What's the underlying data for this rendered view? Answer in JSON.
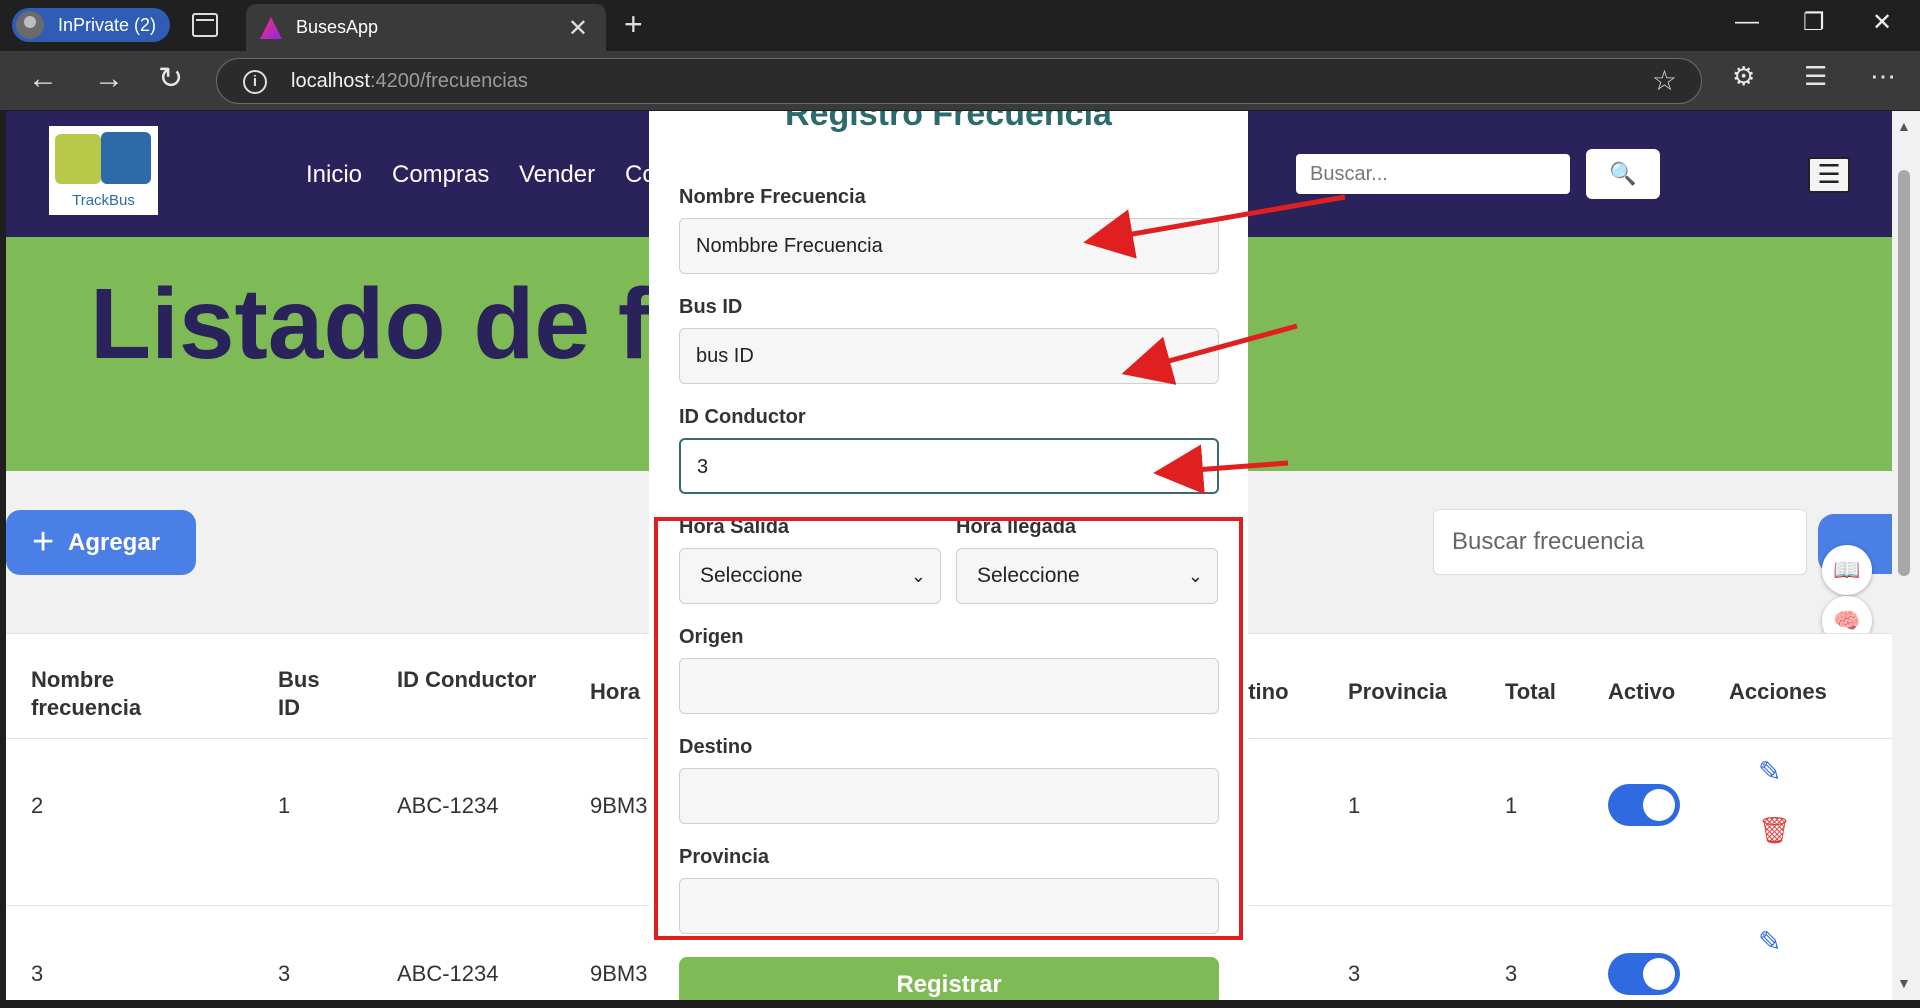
{
  "browser": {
    "profile_label": "InPrivate (2)",
    "tab_title": "BusesApp",
    "tab_close": "✕",
    "new_tab": "+",
    "url_host": "localhost",
    "url_path": ":4200/frecuencias",
    "window_controls": [
      "—",
      "❐",
      "✕"
    ]
  },
  "header": {
    "logo_text": "TrackBus",
    "menu": [
      "Inicio",
      "Compras",
      "Vender",
      "Co"
    ],
    "search_placeholder": "Buscar...",
    "search_icon": "🔍",
    "hamburger": "☰"
  },
  "hero": {
    "title": "Listado de f"
  },
  "list": {
    "add_label": "Agregar",
    "add_icon": "+",
    "search_placeholder": "Buscar frecuencia"
  },
  "table": {
    "headers": [
      "Nombre frecuencia",
      "Bus ID",
      "ID Conductor",
      "Hora",
      "stino",
      "Provincia",
      "Total",
      "Activo",
      "Acciones"
    ],
    "rows": [
      {
        "nombre": "2",
        "bus": "1",
        "conductor": "ABC-1234",
        "hora": "9BM3",
        "provincia": "1",
        "total": "1"
      },
      {
        "nombre": "3",
        "bus": "3",
        "conductor": "ABC-1234",
        "hora": "9BM3",
        "provincia": "3",
        "total": "3"
      }
    ]
  },
  "modal": {
    "title": "Registro Frecuencia",
    "fields": {
      "nombre_label": "Nombre Frecuencia",
      "nombre_value": "Nombbre Frecuencia",
      "bus_label": "Bus ID",
      "bus_value": "bus ID",
      "conductor_label": "ID Conductor",
      "conductor_value": "3",
      "salida_label": "Hora Salida",
      "salida_value": "Seleccione",
      "llegada_label": "Hora llegada",
      "llegada_value": "Seleccione",
      "origen_label": "Origen",
      "destino_label": "Destino",
      "provincia_label": "Provincia"
    },
    "submit_label": "Registrar"
  },
  "icons": {
    "back": "back-arrow-icon",
    "forward": "forward-arrow-icon",
    "refresh": "refresh-icon",
    "edit": "pencil-icon",
    "delete": "trash-icon"
  },
  "colors": {
    "header_bg": "#2a225a",
    "hero_bg": "#7eba55",
    "primary": "#4a7fe6",
    "annotation": "#e02020"
  }
}
